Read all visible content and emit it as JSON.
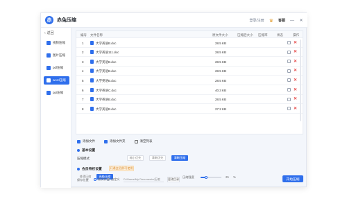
{
  "app": {
    "title": "赤兔压缩",
    "logo_text": "赤"
  },
  "titlebar": {
    "login": "登录/注册",
    "vip": "客服",
    "minimize": "—",
    "close": "✕"
  },
  "sidebar": {
    "back": "返回",
    "items": [
      {
        "label": "视频压缩",
        "icon": "video-icon"
      },
      {
        "label": "图片压缩",
        "icon": "image-icon"
      },
      {
        "label": "pdf压缩",
        "icon": "pdf-icon"
      },
      {
        "label": "word压缩",
        "icon": "word-icon",
        "active": true
      },
      {
        "label": "ppt压缩",
        "icon": "ppt-icon"
      }
    ]
  },
  "table": {
    "headers": [
      "编号",
      "文件名称",
      "原文件大小",
      "压缩后大小",
      "压缩率",
      "状态",
      "操作"
    ],
    "rows": [
      {
        "no": "1",
        "name": "大学英语B.doc",
        "size": "28.5 KB"
      },
      {
        "no": "2",
        "name": "大学英语111.doc",
        "size": "28.5 KB"
      },
      {
        "no": "3",
        "name": "大学英语B.doc",
        "size": "28.5 KB"
      },
      {
        "no": "4",
        "name": "大学英语B.doc",
        "size": "28.5 KB"
      },
      {
        "no": "5",
        "name": "大学英语B.doc",
        "size": "28.5 KB"
      },
      {
        "no": "6",
        "name": "大学英语C.doc",
        "size": "40.3 KB"
      },
      {
        "no": "7",
        "name": "大学英语B.doc",
        "size": "28.5 KB"
      },
      {
        "no": "8",
        "name": "大学英语B.doc",
        "size": "27.2 KB"
      }
    ]
  },
  "actions": {
    "add_file": "添加文件",
    "add_folder": "添加文件夹",
    "clear": "清空列表"
  },
  "basic_settings": {
    "title": "基本设置",
    "mode_label": "压缩模式",
    "modes": [
      "缩小优先",
      "清晰优先",
      "清晰压缩"
    ],
    "selected_mode": "清晰压缩"
  },
  "vip_settings": {
    "title": "会员特权设置",
    "tag": "开通会员即可使用",
    "modes": [
      "普通压缩",
      "高级压缩"
    ],
    "ratio_label": "压缩强度",
    "ratio_value": "25",
    "ratio_unit": "%",
    "ratio_fraction": 0.25
  },
  "footer": {
    "output_label": "保存位置",
    "opt_original": "原文件夹",
    "opt_custom": "自定义",
    "path": "D:/Users/My Documents/压缩",
    "change": "更改目录",
    "start": "开始压缩"
  },
  "colors": {
    "accent": "#2f6fec",
    "danger": "#e54545"
  }
}
